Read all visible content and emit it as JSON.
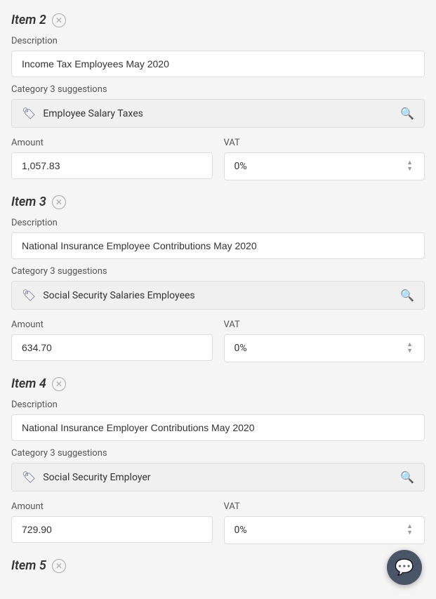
{
  "items": [
    {
      "id": "item2",
      "title": "Item 2",
      "description_label": "Description",
      "description_value": "Income Tax Employees May 2020",
      "description_placeholder": "Description",
      "category_label": "Category 3 suggestions",
      "category_value": "Employee Salary Taxes",
      "amount_label": "Amount",
      "amount_value": "1,057.83",
      "vat_label": "VAT",
      "vat_value": "0%"
    },
    {
      "id": "item3",
      "title": "Item 3",
      "description_label": "Description",
      "description_value": "National Insurance Employee Contributions May 2020",
      "description_placeholder": "Description",
      "category_label": "Category 3 suggestions",
      "category_value": "Social Security Salaries Employees",
      "amount_label": "Amount",
      "amount_value": "634.70",
      "vat_label": "VAT",
      "vat_value": "0%"
    },
    {
      "id": "item4",
      "title": "Item 4",
      "description_label": "Description",
      "description_value": "National Insurance Employer Contributions May 2020",
      "description_placeholder": "Description",
      "category_label": "Category 3 suggestions",
      "category_value": "Social Security Employer",
      "amount_label": "Amount",
      "amount_value": "729.90",
      "vat_label": "VAT",
      "vat_value": "0%"
    }
  ],
  "item5": {
    "title": "Item 5"
  },
  "chat_button": {
    "label": "Chat"
  }
}
